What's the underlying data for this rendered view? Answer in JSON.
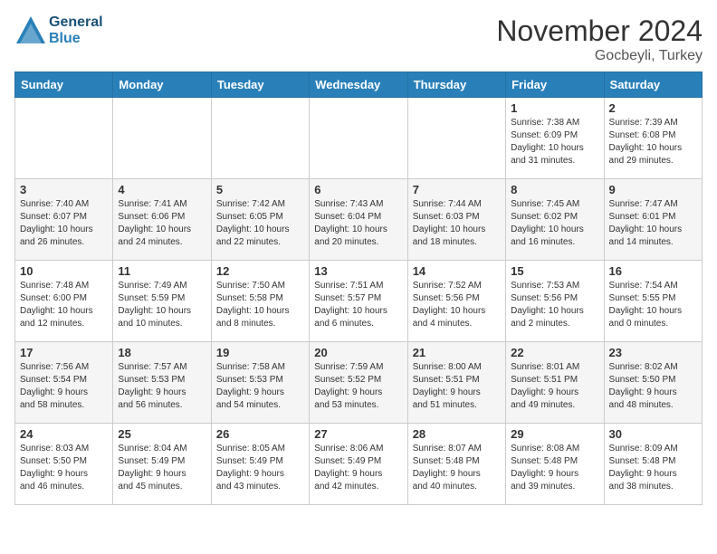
{
  "header": {
    "logo_line1": "General",
    "logo_line2": "Blue",
    "month_title": "November 2024",
    "location": "Gocbeyli, Turkey"
  },
  "weekdays": [
    "Sunday",
    "Monday",
    "Tuesday",
    "Wednesday",
    "Thursday",
    "Friday",
    "Saturday"
  ],
  "weeks": [
    [
      {
        "day": "",
        "text": ""
      },
      {
        "day": "",
        "text": ""
      },
      {
        "day": "",
        "text": ""
      },
      {
        "day": "",
        "text": ""
      },
      {
        "day": "",
        "text": ""
      },
      {
        "day": "1",
        "text": "Sunrise: 7:38 AM\nSunset: 6:09 PM\nDaylight: 10 hours\nand 31 minutes."
      },
      {
        "day": "2",
        "text": "Sunrise: 7:39 AM\nSunset: 6:08 PM\nDaylight: 10 hours\nand 29 minutes."
      }
    ],
    [
      {
        "day": "3",
        "text": "Sunrise: 7:40 AM\nSunset: 6:07 PM\nDaylight: 10 hours\nand 26 minutes."
      },
      {
        "day": "4",
        "text": "Sunrise: 7:41 AM\nSunset: 6:06 PM\nDaylight: 10 hours\nand 24 minutes."
      },
      {
        "day": "5",
        "text": "Sunrise: 7:42 AM\nSunset: 6:05 PM\nDaylight: 10 hours\nand 22 minutes."
      },
      {
        "day": "6",
        "text": "Sunrise: 7:43 AM\nSunset: 6:04 PM\nDaylight: 10 hours\nand 20 minutes."
      },
      {
        "day": "7",
        "text": "Sunrise: 7:44 AM\nSunset: 6:03 PM\nDaylight: 10 hours\nand 18 minutes."
      },
      {
        "day": "8",
        "text": "Sunrise: 7:45 AM\nSunset: 6:02 PM\nDaylight: 10 hours\nand 16 minutes."
      },
      {
        "day": "9",
        "text": "Sunrise: 7:47 AM\nSunset: 6:01 PM\nDaylight: 10 hours\nand 14 minutes."
      }
    ],
    [
      {
        "day": "10",
        "text": "Sunrise: 7:48 AM\nSunset: 6:00 PM\nDaylight: 10 hours\nand 12 minutes."
      },
      {
        "day": "11",
        "text": "Sunrise: 7:49 AM\nSunset: 5:59 PM\nDaylight: 10 hours\nand 10 minutes."
      },
      {
        "day": "12",
        "text": "Sunrise: 7:50 AM\nSunset: 5:58 PM\nDaylight: 10 hours\nand 8 minutes."
      },
      {
        "day": "13",
        "text": "Sunrise: 7:51 AM\nSunset: 5:57 PM\nDaylight: 10 hours\nand 6 minutes."
      },
      {
        "day": "14",
        "text": "Sunrise: 7:52 AM\nSunset: 5:56 PM\nDaylight: 10 hours\nand 4 minutes."
      },
      {
        "day": "15",
        "text": "Sunrise: 7:53 AM\nSunset: 5:56 PM\nDaylight: 10 hours\nand 2 minutes."
      },
      {
        "day": "16",
        "text": "Sunrise: 7:54 AM\nSunset: 5:55 PM\nDaylight: 10 hours\nand 0 minutes."
      }
    ],
    [
      {
        "day": "17",
        "text": "Sunrise: 7:56 AM\nSunset: 5:54 PM\nDaylight: 9 hours\nand 58 minutes."
      },
      {
        "day": "18",
        "text": "Sunrise: 7:57 AM\nSunset: 5:53 PM\nDaylight: 9 hours\nand 56 minutes."
      },
      {
        "day": "19",
        "text": "Sunrise: 7:58 AM\nSunset: 5:53 PM\nDaylight: 9 hours\nand 54 minutes."
      },
      {
        "day": "20",
        "text": "Sunrise: 7:59 AM\nSunset: 5:52 PM\nDaylight: 9 hours\nand 53 minutes."
      },
      {
        "day": "21",
        "text": "Sunrise: 8:00 AM\nSunset: 5:51 PM\nDaylight: 9 hours\nand 51 minutes."
      },
      {
        "day": "22",
        "text": "Sunrise: 8:01 AM\nSunset: 5:51 PM\nDaylight: 9 hours\nand 49 minutes."
      },
      {
        "day": "23",
        "text": "Sunrise: 8:02 AM\nSunset: 5:50 PM\nDaylight: 9 hours\nand 48 minutes."
      }
    ],
    [
      {
        "day": "24",
        "text": "Sunrise: 8:03 AM\nSunset: 5:50 PM\nDaylight: 9 hours\nand 46 minutes."
      },
      {
        "day": "25",
        "text": "Sunrise: 8:04 AM\nSunset: 5:49 PM\nDaylight: 9 hours\nand 45 minutes."
      },
      {
        "day": "26",
        "text": "Sunrise: 8:05 AM\nSunset: 5:49 PM\nDaylight: 9 hours\nand 43 minutes."
      },
      {
        "day": "27",
        "text": "Sunrise: 8:06 AM\nSunset: 5:49 PM\nDaylight: 9 hours\nand 42 minutes."
      },
      {
        "day": "28",
        "text": "Sunrise: 8:07 AM\nSunset: 5:48 PM\nDaylight: 9 hours\nand 40 minutes."
      },
      {
        "day": "29",
        "text": "Sunrise: 8:08 AM\nSunset: 5:48 PM\nDaylight: 9 hours\nand 39 minutes."
      },
      {
        "day": "30",
        "text": "Sunrise: 8:09 AM\nSunset: 5:48 PM\nDaylight: 9 hours\nand 38 minutes."
      }
    ]
  ]
}
